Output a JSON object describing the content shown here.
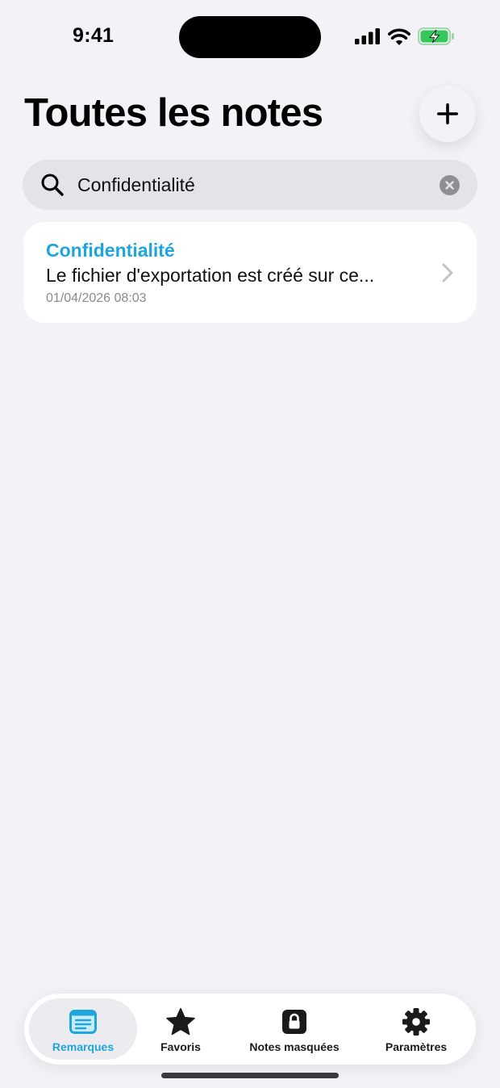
{
  "status_bar": {
    "time": "9:41"
  },
  "header": {
    "title": "Toutes les notes"
  },
  "search": {
    "value": "Confidentialité"
  },
  "notes": [
    {
      "title": "Confidentialité",
      "preview": "Le fichier d'exportation est créé sur ce...",
      "date": "01/04/2026 08:03"
    }
  ],
  "tabs": [
    {
      "label": "Remarques",
      "icon": "note-icon",
      "active": true
    },
    {
      "label": "Favoris",
      "icon": "star-icon",
      "active": false
    },
    {
      "label": "Notes masquées",
      "icon": "lock-icon",
      "active": false
    },
    {
      "label": "Paramètres",
      "icon": "gear-icon",
      "active": false
    }
  ],
  "colors": {
    "accent": "#1ea5dc",
    "background": "#f2f2f7",
    "card": "#ffffff",
    "battery": "#34c759"
  }
}
